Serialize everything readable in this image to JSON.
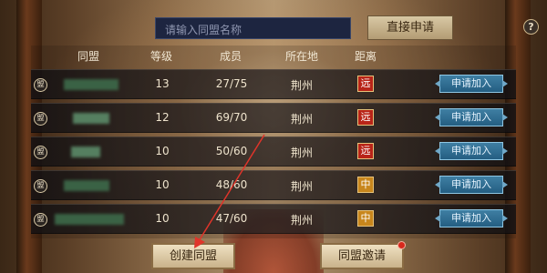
{
  "top": {
    "search_placeholder": "请输入同盟名称",
    "apply_label": "直接申请",
    "help_label": "?"
  },
  "headers": {
    "alliance": "同盟",
    "level": "等级",
    "members": "成员",
    "location": "所在地",
    "distance": "距离"
  },
  "seal_glyph": "盟",
  "rows": [
    {
      "level": "13",
      "members": "27/75",
      "location": "荆州",
      "distance": "远",
      "distance_color": "#b82418",
      "join_label": "申请加入"
    },
    {
      "level": "12",
      "members": "69/70",
      "location": "荆州",
      "distance": "远",
      "distance_color": "#b82418",
      "join_label": "申请加入"
    },
    {
      "level": "10",
      "members": "50/60",
      "location": "荆州",
      "distance": "远",
      "distance_color": "#b82418",
      "join_label": "申请加入"
    },
    {
      "level": "10",
      "members": "48/60",
      "location": "荆州",
      "distance": "中",
      "distance_color": "#c8861c",
      "join_label": "申请加入"
    },
    {
      "level": "10",
      "members": "47/60",
      "location": "荆州",
      "distance": "中",
      "distance_color": "#c8861c",
      "join_label": "申请加入"
    }
  ],
  "bottom": {
    "create_label": "创建同盟",
    "invite_label": "同盟邀请"
  },
  "colors": {
    "annotation_arrow": "#e0342a",
    "notification_dot": "#d8281c"
  }
}
